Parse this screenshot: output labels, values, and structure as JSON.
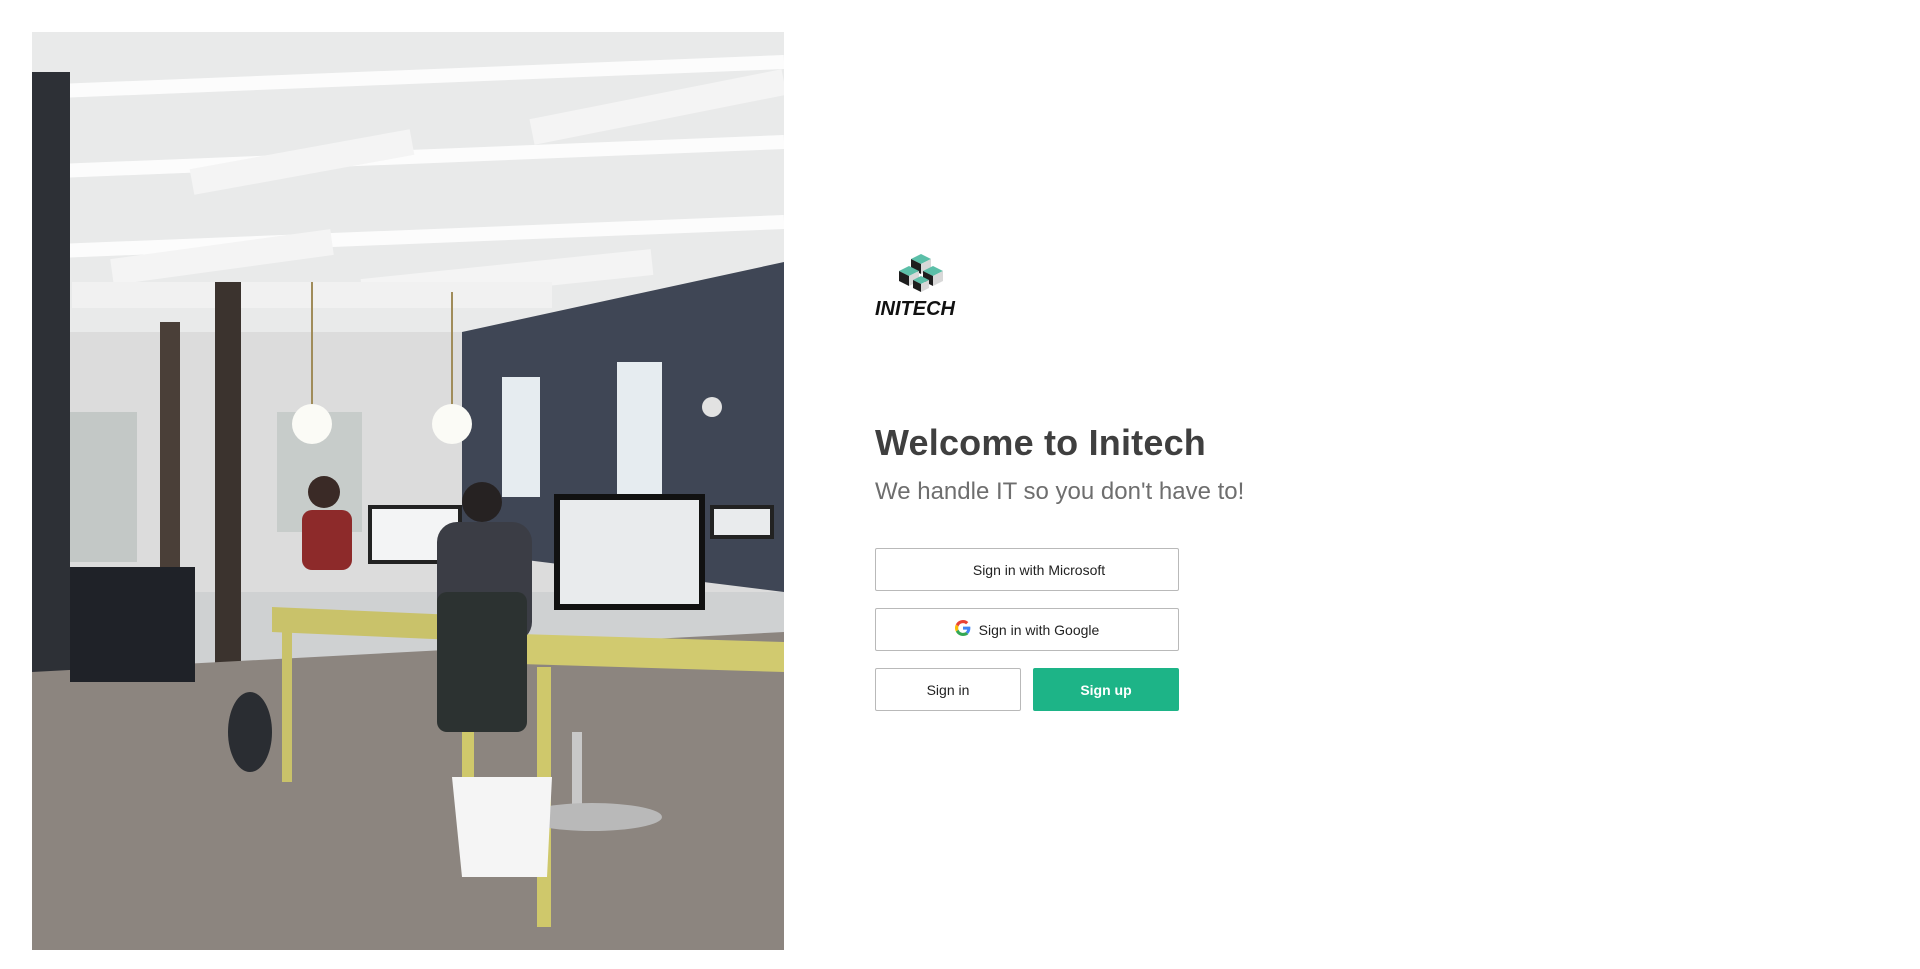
{
  "brand": {
    "logo_text": "INITECH",
    "logo_colors": {
      "teal": "#5bbfa8",
      "dark": "#1e1e1e",
      "light": "#d8d8d8"
    }
  },
  "hero": {
    "icon": "office-photo"
  },
  "welcome": {
    "title": "Welcome to Initech",
    "tagline": "We handle IT so you don't have to!"
  },
  "auth": {
    "microsoft_label": "Sign in with Microsoft",
    "google_label": "Sign in with Google",
    "signin_label": "Sign in",
    "signup_label": "Sign up",
    "microsoft_colors": [
      "#f25022",
      "#7fba00",
      "#00a4ef",
      "#ffb900"
    ],
    "accent": "#1db487"
  }
}
